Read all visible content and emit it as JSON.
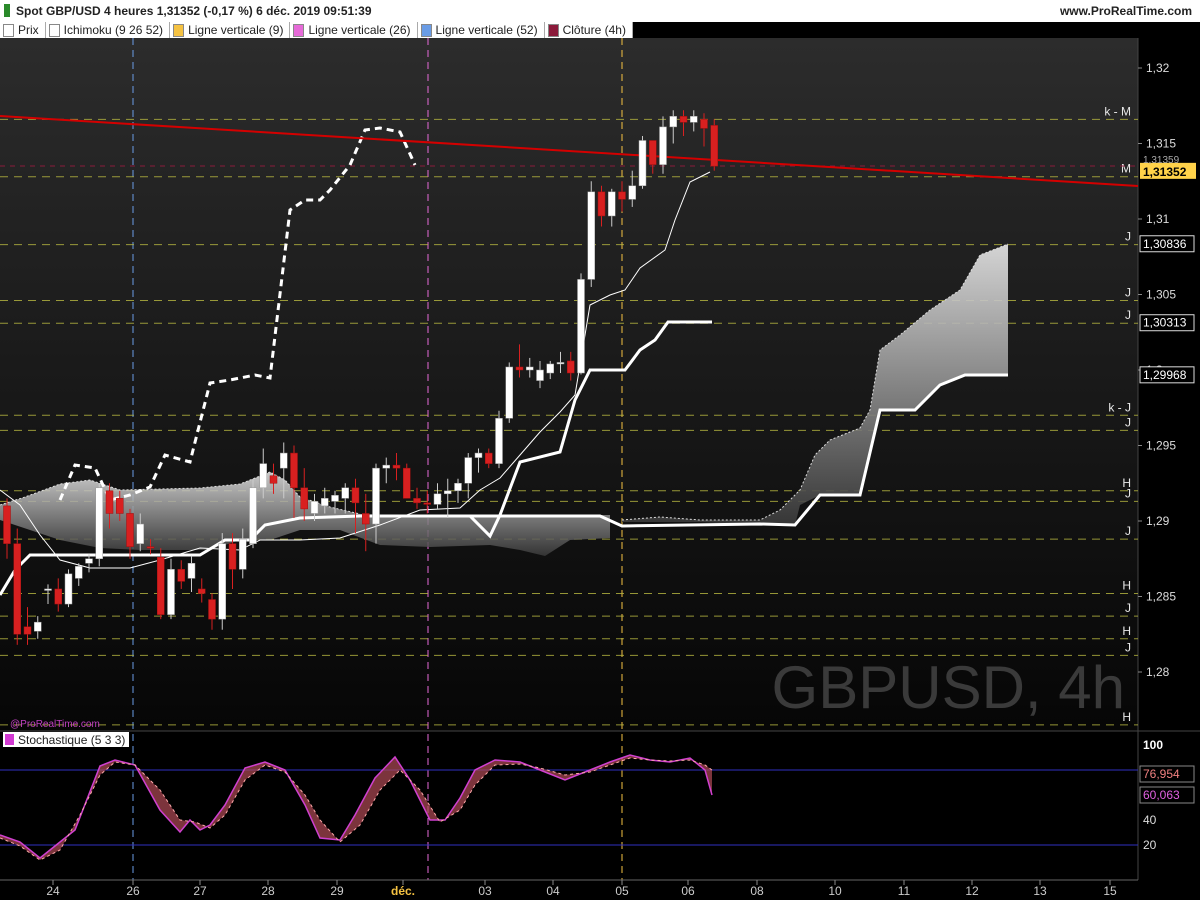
{
  "header": {
    "title": "Spot GBP/USD 4 heures 1,31352 (-0,17 %) 6 déc. 2019 09:51:39",
    "site": "www.ProRealTime.com"
  },
  "legend": [
    {
      "label": "Prix",
      "color": "#ffffff"
    },
    {
      "label": "Ichimoku (9 26 52)",
      "color": "#ffffff"
    },
    {
      "label": "Ligne verticale (9)",
      "color": "#f5c242"
    },
    {
      "label": "Ligne verticale (26)",
      "color": "#e66ad8"
    },
    {
      "label": "Ligne verticale (52)",
      "color": "#6a9ce6"
    },
    {
      "label": "Clôture (4h)",
      "color": "#8b1a3a"
    }
  ],
  "watermark": "GBPUSD, 4h",
  "prt_link": "@ProRealTime.com",
  "stoch": {
    "label": "Stochastique (5 3 3)",
    "color": "#d23ad2",
    "k_value": "76,954",
    "d_value": "60,063",
    "levels": [
      80,
      20
    ]
  },
  "chart_data": {
    "type": "candlestick",
    "price_axis": {
      "ticks": [
        "1,28",
        "1,285",
        "1,29",
        "1,295",
        "1,3",
        "1,305",
        "1,31",
        "1,315",
        "1,32"
      ]
    },
    "price_badges": [
      {
        "label": "1,31352",
        "price": 1.31352,
        "style": "current"
      },
      {
        "label": "1,31359",
        "price": 1.31359,
        "style": "small"
      },
      {
        "label": "1,30836",
        "price": 1.30836,
        "style": "box"
      },
      {
        "label": "1,30313",
        "price": 1.30313,
        "style": "box"
      },
      {
        "label": "1,29968",
        "price": 1.29968,
        "style": "box"
      }
    ],
    "levels": [
      {
        "label": "k - M",
        "price": 1.3166
      },
      {
        "label": "M",
        "price": 1.3128
      },
      {
        "label": "J",
        "price": 1.3083
      },
      {
        "label": "J",
        "price": 1.3046
      },
      {
        "label": "J",
        "price": 1.3031
      },
      {
        "label": "k - J",
        "price": 1.297
      },
      {
        "label": "J",
        "price": 1.296
      },
      {
        "label": "H",
        "price": 1.292
      },
      {
        "label": "J",
        "price": 1.2913
      },
      {
        "label": "J",
        "price": 1.2888
      },
      {
        "label": "H",
        "price": 1.2852
      },
      {
        "label": "J",
        "price": 1.2837
      },
      {
        "label": "H",
        "price": 1.2822
      },
      {
        "label": "J",
        "price": 1.2811
      },
      {
        "label": "H",
        "price": 1.2765
      }
    ],
    "x_labels": [
      "24",
      "26",
      "27",
      "28",
      "29",
      "déc.",
      "03",
      "04",
      "05",
      "06",
      "08",
      "10",
      "11",
      "12",
      "13",
      "15"
    ],
    "candles": [
      [
        1.291,
        1.2915,
        1.2875,
        1.2885
      ],
      [
        1.2885,
        1.2895,
        1.2818,
        1.2825
      ],
      [
        1.283,
        1.2843,
        1.2818,
        1.2825
      ],
      [
        1.2827,
        1.2837,
        1.2822,
        1.2833
      ],
      [
        1.2855,
        1.2858,
        1.2845,
        1.2855
      ],
      [
        1.2855,
        1.2862,
        1.284,
        1.2845
      ],
      [
        1.2845,
        1.2868,
        1.2843,
        1.2865
      ],
      [
        1.2862,
        1.2872,
        1.2857,
        1.287
      ],
      [
        1.2872,
        1.2878,
        1.2866,
        1.2875
      ],
      [
        1.2875,
        1.2925,
        1.287,
        1.2922
      ],
      [
        1.292,
        1.2925,
        1.2895,
        1.2905
      ],
      [
        1.2915,
        1.292,
        1.29,
        1.2905
      ],
      [
        1.2905,
        1.2908,
        1.2875,
        1.2883
      ],
      [
        1.2885,
        1.2905,
        1.288,
        1.2898
      ],
      [
        1.2883,
        1.2888,
        1.2878,
        1.2882
      ],
      [
        1.2876,
        1.2882,
        1.2835,
        1.2838
      ],
      [
        1.2838,
        1.2875,
        1.2835,
        1.2868
      ],
      [
        1.2868,
        1.2874,
        1.2855,
        1.286
      ],
      [
        1.2862,
        1.2877,
        1.2853,
        1.2872
      ],
      [
        1.2855,
        1.2862,
        1.2846,
        1.2852
      ],
      [
        1.2848,
        1.2852,
        1.2828,
        1.2835
      ],
      [
        1.2835,
        1.2892,
        1.2828,
        1.2885
      ],
      [
        1.2885,
        1.2892,
        1.2855,
        1.2868
      ],
      [
        1.2868,
        1.2895,
        1.2862,
        1.2888
      ],
      [
        1.2885,
        1.2928,
        1.2882,
        1.2922
      ],
      [
        1.2922,
        1.2948,
        1.2915,
        1.2938
      ],
      [
        1.293,
        1.2938,
        1.2918,
        1.2925
      ],
      [
        1.2935,
        1.2952,
        1.2915,
        1.2945
      ],
      [
        1.2945,
        1.295,
        1.2902,
        1.2922
      ],
      [
        1.2922,
        1.2935,
        1.29,
        1.2908
      ],
      [
        1.2905,
        1.2918,
        1.29,
        1.2913
      ],
      [
        1.291,
        1.2922,
        1.2905,
        1.2915
      ],
      [
        1.2913,
        1.292,
        1.2905,
        1.2917
      ],
      [
        1.2915,
        1.2925,
        1.2905,
        1.2922
      ],
      [
        1.2922,
        1.2928,
        1.2892,
        1.2912
      ],
      [
        1.2905,
        1.2918,
        1.288,
        1.2898
      ],
      [
        1.2898,
        1.2938,
        1.2885,
        1.2935
      ],
      [
        1.2935,
        1.2942,
        1.2925,
        1.2937
      ],
      [
        1.2937,
        1.2945,
        1.2927,
        1.2935
      ],
      [
        1.2935,
        1.2938,
        1.2915,
        1.2915
      ],
      [
        1.2915,
        1.2922,
        1.2908,
        1.2912
      ],
      [
        1.2912,
        1.292,
        1.2905,
        1.2911
      ],
      [
        1.2911,
        1.2925,
        1.2908,
        1.2918
      ],
      [
        1.2918,
        1.2928,
        1.2902,
        1.292
      ],
      [
        1.292,
        1.2928,
        1.2912,
        1.2925
      ],
      [
        1.2925,
        1.2945,
        1.2915,
        1.2942
      ],
      [
        1.2942,
        1.2948,
        1.2932,
        1.2945
      ],
      [
        1.2945,
        1.2948,
        1.2935,
        1.2938
      ],
      [
        1.2938,
        1.2973,
        1.2935,
        1.2968
      ],
      [
        1.2968,
        1.3005,
        1.2965,
        1.3002
      ],
      [
        1.3002,
        1.3017,
        1.2995,
        1.3
      ],
      [
        1.3,
        1.3008,
        1.2995,
        1.3002
      ],
      [
        1.2993,
        1.3006,
        1.2988,
        1.3
      ],
      [
        1.2998,
        1.3006,
        1.2994,
        1.3004
      ],
      [
        1.3004,
        1.3012,
        1.2998,
        1.3005
      ],
      [
        1.3006,
        1.3012,
        1.2993,
        1.2998
      ],
      [
        1.2998,
        1.3064,
        1.2997,
        1.306
      ],
      [
        1.306,
        1.3125,
        1.3055,
        1.3118
      ],
      [
        1.3118,
        1.3122,
        1.3095,
        1.3102
      ],
      [
        1.3102,
        1.312,
        1.3095,
        1.3118
      ],
      [
        1.3118,
        1.3125,
        1.3105,
        1.3113
      ],
      [
        1.3113,
        1.3132,
        1.3108,
        1.3122
      ],
      [
        1.3122,
        1.3155,
        1.312,
        1.3152
      ],
      [
        1.3152,
        1.3148,
        1.313,
        1.3136
      ],
      [
        1.3136,
        1.3168,
        1.313,
        1.3161
      ],
      [
        1.3161,
        1.3172,
        1.315,
        1.3168
      ],
      [
        1.3168,
        1.3172,
        1.3155,
        1.3164
      ],
      [
        1.3164,
        1.3172,
        1.3158,
        1.3168
      ],
      [
        1.3166,
        1.317,
        1.3148,
        1.316
      ],
      [
        1.3162,
        1.3166,
        1.3132,
        1.3135
      ]
    ]
  }
}
